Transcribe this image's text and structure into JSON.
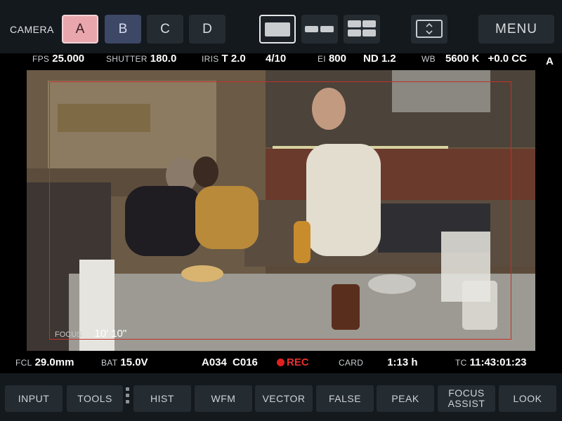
{
  "header": {
    "camera_label": "CAMERA",
    "cameras": [
      "A",
      "B",
      "C",
      "D"
    ],
    "menu_label": "MENU"
  },
  "status_top": {
    "fps": {
      "label": "FPS",
      "value": "25.000"
    },
    "shutter": {
      "label": "SHUTTER",
      "value": "180.0"
    },
    "iris": {
      "label": "IRIS",
      "value": "T 2.0"
    },
    "iris_fraction": "4/10",
    "ei": {
      "label": "EI",
      "value": "800"
    },
    "nd": "ND 1.2",
    "wb": {
      "label": "WB",
      "value": "5600 K",
      "cc": "+0.0 CC"
    },
    "camera_indicator": "A"
  },
  "overlay": {
    "focus_label": "FOCUS",
    "focus_value": "10' 10\""
  },
  "status_bottom": {
    "fcl": {
      "label": "FCL",
      "value": "29.0mm"
    },
    "bat": {
      "label": "BAT",
      "value": "15.0V"
    },
    "clip": "A034",
    "clip_num": "C016",
    "rec": "REC",
    "card": {
      "label": "CARD",
      "value": "1:13 h"
    },
    "tc": {
      "label": "TC",
      "value": "11:43:01:23"
    }
  },
  "toolbar": {
    "input": "INPUT",
    "tools": "TOOLS",
    "hist": "HIST",
    "wfm": "WFM",
    "vector": "VECTOR",
    "false": "FALSE",
    "peak": "PEAK",
    "focus_assist_1": "FOCUS",
    "focus_assist_2": "ASSIST",
    "look": "LOOK"
  },
  "colors": {
    "rec": "#e02020",
    "frame_line": "#c0322b",
    "camera_a": "#e9a7ad",
    "camera_b": "#3d4766"
  }
}
